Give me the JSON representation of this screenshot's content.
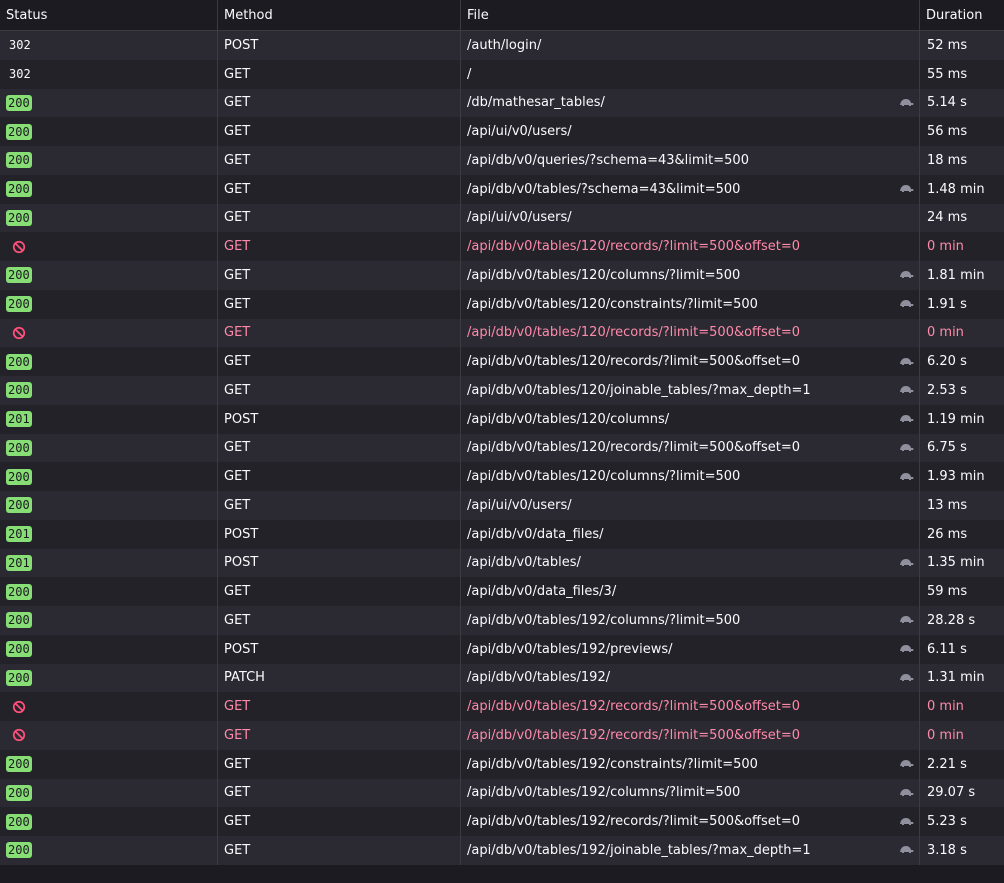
{
  "header": {
    "status": "Status",
    "method": "Method",
    "file": "File",
    "duration": "Duration"
  },
  "colors": {
    "ok_badge": "#86de74",
    "blocked_text": "#ff8aa9"
  },
  "rows": [
    {
      "status": "302",
      "kind": "redir",
      "method": "POST",
      "file": "/auth/login/",
      "duration": "52 ms",
      "slow": false
    },
    {
      "status": "302",
      "kind": "redir",
      "method": "GET",
      "file": "/",
      "duration": "55 ms",
      "slow": false
    },
    {
      "status": "200",
      "kind": "ok",
      "method": "GET",
      "file": "/db/mathesar_tables/",
      "duration": "5.14 s",
      "slow": true
    },
    {
      "status": "200",
      "kind": "ok",
      "method": "GET",
      "file": "/api/ui/v0/users/",
      "duration": "56 ms",
      "slow": false
    },
    {
      "status": "200",
      "kind": "ok",
      "method": "GET",
      "file": "/api/db/v0/queries/?schema=43&limit=500",
      "duration": "18 ms",
      "slow": false
    },
    {
      "status": "200",
      "kind": "ok",
      "method": "GET",
      "file": "/api/db/v0/tables/?schema=43&limit=500",
      "duration": "1.48 min",
      "slow": true
    },
    {
      "status": "200",
      "kind": "ok",
      "method": "GET",
      "file": "/api/ui/v0/users/",
      "duration": "24 ms",
      "slow": false
    },
    {
      "status": "",
      "kind": "blocked",
      "method": "GET",
      "file": "/api/db/v0/tables/120/records/?limit=500&offset=0",
      "duration": "0 min",
      "slow": false
    },
    {
      "status": "200",
      "kind": "ok",
      "method": "GET",
      "file": "/api/db/v0/tables/120/columns/?limit=500",
      "duration": "1.81 min",
      "slow": true
    },
    {
      "status": "200",
      "kind": "ok",
      "method": "GET",
      "file": "/api/db/v0/tables/120/constraints/?limit=500",
      "duration": "1.91 s",
      "slow": true
    },
    {
      "status": "",
      "kind": "blocked",
      "method": "GET",
      "file": "/api/db/v0/tables/120/records/?limit=500&offset=0",
      "duration": "0 min",
      "slow": false
    },
    {
      "status": "200",
      "kind": "ok",
      "method": "GET",
      "file": "/api/db/v0/tables/120/records/?limit=500&offset=0",
      "duration": "6.20 s",
      "slow": true
    },
    {
      "status": "200",
      "kind": "ok",
      "method": "GET",
      "file": "/api/db/v0/tables/120/joinable_tables/?max_depth=1",
      "duration": "2.53 s",
      "slow": true
    },
    {
      "status": "201",
      "kind": "ok",
      "method": "POST",
      "file": "/api/db/v0/tables/120/columns/",
      "duration": "1.19 min",
      "slow": true
    },
    {
      "status": "200",
      "kind": "ok",
      "method": "GET",
      "file": "/api/db/v0/tables/120/records/?limit=500&offset=0",
      "duration": "6.75 s",
      "slow": true
    },
    {
      "status": "200",
      "kind": "ok",
      "method": "GET",
      "file": "/api/db/v0/tables/120/columns/?limit=500",
      "duration": "1.93 min",
      "slow": true
    },
    {
      "status": "200",
      "kind": "ok",
      "method": "GET",
      "file": "/api/ui/v0/users/",
      "duration": "13 ms",
      "slow": false
    },
    {
      "status": "201",
      "kind": "ok",
      "method": "POST",
      "file": "/api/db/v0/data_files/",
      "duration": "26 ms",
      "slow": false
    },
    {
      "status": "201",
      "kind": "ok",
      "method": "POST",
      "file": "/api/db/v0/tables/",
      "duration": "1.35 min",
      "slow": true
    },
    {
      "status": "200",
      "kind": "ok",
      "method": "GET",
      "file": "/api/db/v0/data_files/3/",
      "duration": "59 ms",
      "slow": false
    },
    {
      "status": "200",
      "kind": "ok",
      "method": "GET",
      "file": "/api/db/v0/tables/192/columns/?limit=500",
      "duration": "28.28 s",
      "slow": true
    },
    {
      "status": "200",
      "kind": "ok",
      "method": "POST",
      "file": "/api/db/v0/tables/192/previews/",
      "duration": "6.11 s",
      "slow": true
    },
    {
      "status": "200",
      "kind": "ok",
      "method": "PATCH",
      "file": "/api/db/v0/tables/192/",
      "duration": "1.31 min",
      "slow": true
    },
    {
      "status": "",
      "kind": "blocked",
      "method": "GET",
      "file": "/api/db/v0/tables/192/records/?limit=500&offset=0",
      "duration": "0 min",
      "slow": false
    },
    {
      "status": "",
      "kind": "blocked",
      "method": "GET",
      "file": "/api/db/v0/tables/192/records/?limit=500&offset=0",
      "duration": "0 min",
      "slow": false
    },
    {
      "status": "200",
      "kind": "ok",
      "method": "GET",
      "file": "/api/db/v0/tables/192/constraints/?limit=500",
      "duration": "2.21 s",
      "slow": true
    },
    {
      "status": "200",
      "kind": "ok",
      "method": "GET",
      "file": "/api/db/v0/tables/192/columns/?limit=500",
      "duration": "29.07 s",
      "slow": true
    },
    {
      "status": "200",
      "kind": "ok",
      "method": "GET",
      "file": "/api/db/v0/tables/192/records/?limit=500&offset=0",
      "duration": "5.23 s",
      "slow": true
    },
    {
      "status": "200",
      "kind": "ok",
      "method": "GET",
      "file": "/api/db/v0/tables/192/joinable_tables/?max_depth=1",
      "duration": "3.18 s",
      "slow": true
    }
  ]
}
